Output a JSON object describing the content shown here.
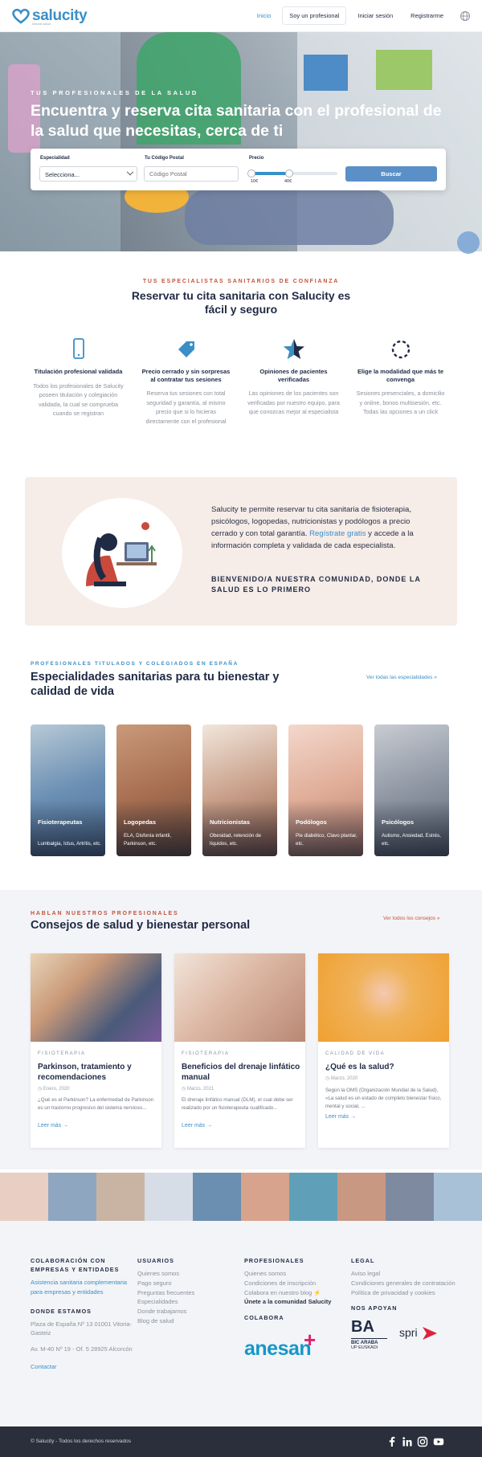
{
  "header": {
    "logo_text": "salucity",
    "logo_sub": "natural salud",
    "nav": [
      "Inicio",
      "Soy un profesional",
      "Iniciar sesión",
      "Registrarme"
    ]
  },
  "hero": {
    "eyebrow": "TUS PROFESIONALES DE LA SALUD",
    "title": "Encuentra y reserva cita sanitaria con el profesional de la salud que necesitas, cerca de ti",
    "specialty_label": "Especialidad",
    "specialty_value": "Selecciona...",
    "postal_label": "Tu Código Postal",
    "postal_placeholder": "Código Postal",
    "price_label": "Precio",
    "price_min": "10€",
    "price_max": "40€",
    "search_button": "Buscar"
  },
  "trust": {
    "eyebrow": "TUS ESPECIALISTAS SANITARIOS DE CONFIANZA",
    "title": "Reservar tu cita sanitaria con Salucity es fácil y seguro",
    "features": [
      {
        "title": "Titulación profesional validada",
        "text": "Todos los profesionales de Salucity poseen titulación y colegiación validada, la cual se comprueba cuando se registran"
      },
      {
        "title": "Precio cerrado y sin sorpresas al contratar tus sesiones",
        "text": "Reserva tus sesiones con total seguridad y garantía, al mismo precio que si lo hicieras directamente con el profesional"
      },
      {
        "title": "Opiniones de pacientes verificadas",
        "text": "Las opiniones de los pacientes son verificadas por nuestro equipo, para que conozcas mejor al especialista"
      },
      {
        "title": "Elige la modalidad que más te convenga",
        "text": "Sesiones presenciales, a domicilio y online, bonos multisesión, etc. Todas las opciones a un click"
      }
    ]
  },
  "community": {
    "text_before": "Salucity te permite reservar tu cita sanitaria de fisioterapia, psicólogos, logopedas, nutricionistas y podólogos a precio cerrado y con total garantía. ",
    "link": "Regístrate gratis",
    "text_after": " y accede a la información completa y validada de cada especialista.",
    "bold": "BIENVENIDO/A NUESTRA COMUNIDAD, DONDE LA SALUD ES LO PRIMERO"
  },
  "specialties": {
    "eyebrow": "PROFESIONALES TITULADOS Y COLEGIADOS EN ESPAÑA",
    "title": "Especialidades sanitarias para tu bienestar y calidad de vida",
    "see_all": "Ver todas las especialidades",
    "items": [
      {
        "name": "Fisioterapeutas",
        "desc": "Lumbalgia, Ictus, Artritis, etc."
      },
      {
        "name": "Logopedas",
        "desc": "ELA, Disfonía infantil, Parkinson, etc."
      },
      {
        "name": "Nutricionistas",
        "desc": "Obesidad, retención de líquidos, etc."
      },
      {
        "name": "Podólogos",
        "desc": "Pie diabético, Clavo plantar, etc."
      },
      {
        "name": "Psicólogos",
        "desc": "Autismo, Ansiedad, Estrés, etc."
      }
    ]
  },
  "advice": {
    "eyebrow": "HABLAN NUESTROS PROFESIONALES",
    "title": "Consejos de salud y bienestar personal",
    "see_all": "Ver todos los consejos",
    "posts": [
      {
        "category": "FISIOTERAPIA",
        "title": "Parkinson, tratamiento y recomendaciones",
        "date": "Enero, 2020",
        "excerpt": "¿Qué es el Parkinson? La enfermedad de Parkinson es un trastorno progresivo del sistema nervioso...",
        "more": "Leer más"
      },
      {
        "category": "FISIOTERAPIA",
        "title": "Beneficios del drenaje linfático manual",
        "date": "Marzo, 2021",
        "excerpt": "El drenaje linfático manual (DLM), el cual debe ser realizado por un fisioterapeuta cualificado...",
        "more": "Leer más"
      },
      {
        "category": "CALIDAD DE VIDA",
        "title": "¿Qué es la salud?",
        "date": "Marzo, 2020",
        "excerpt": "Según la OMS (Organización Mundial de la Salud), «La salud es un estado de completo bienestar físico, mental y social, ...",
        "more": "Leer más"
      }
    ]
  },
  "footer": {
    "collab_title": "COLABORACIÓN CON EMPRESAS Y ENTIDADES",
    "collab_link": "Asistencia sanitaria complementaria para empresas y entidades",
    "where_title": "DONDE ESTAMOS",
    "address1": "Plaza de España Nº 13 01001 Vitoria-Gasteiz",
    "address2": "Av. M-40 Nº 19 - Of. 5 28925 Alcorcón",
    "contact": "Contactar",
    "users_title": "USUARIOS",
    "users_links": [
      "Quienes somos",
      "Pago seguro",
      "Preguntas frecuentes",
      "Especialidades",
      "Donde trabajamos",
      "Blog de salud"
    ],
    "pros_title": "PROFESIONALES",
    "pros_links": [
      "Quienes somos",
      "Condiciones de inscripción",
      "Colabora en nuestro blog"
    ],
    "pros_bold": "Únete a la comunidad Salucity",
    "colab_head": "COLABORA",
    "colab_logo": "anesan",
    "legal_title": "LEGAL",
    "legal_links": [
      "Aviso legal",
      "Condiciones generales de contratación",
      "Política de privacidad y cookies"
    ],
    "support_head": "NOS APOYAN",
    "support_logo1": "BA",
    "support_logo1_sub": "BIC ARABA",
    "support_logo1_sub2": "UP EUSKADI",
    "support_logo2": "spri",
    "copyright": "© Salucity - Todos los derechos reservados"
  },
  "colors": {
    "brand": "#3a8fc7",
    "accent": "#c4533a",
    "dark": "#2a2f3b"
  }
}
